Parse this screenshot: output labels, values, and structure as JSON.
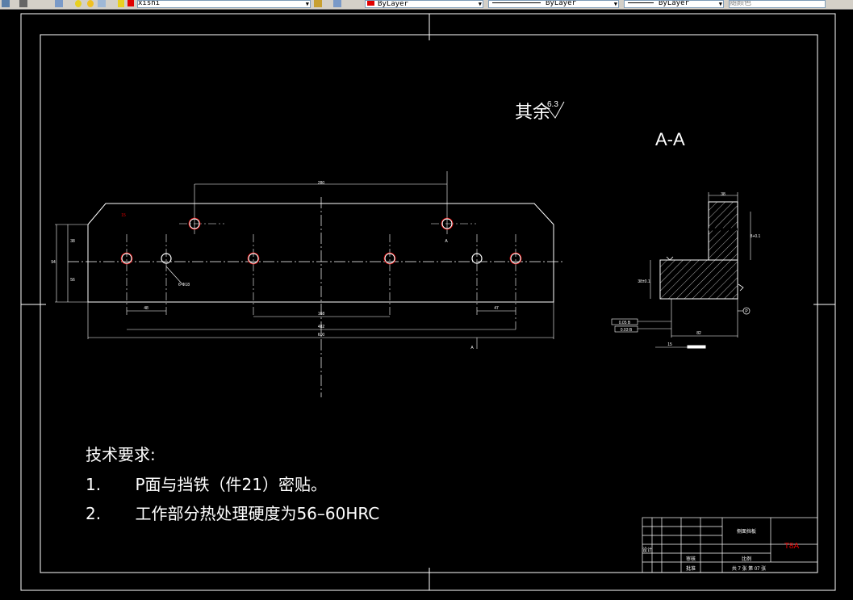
{
  "toolbar": {
    "layer_name": "xishi",
    "color_label": "ByLayer",
    "linetype_label": "ByLayer",
    "lineweight_label": "ByLayer",
    "plotstyle_label": "随颜色"
  },
  "drawing": {
    "surface_note_prefix": "其余",
    "surface_note_value": "6.3",
    "section_label": "A-A",
    "tech_title": "技术要求:",
    "tech_items": [
      {
        "num": "1.",
        "text": "P面与挡铁（件21）密贴。"
      },
      {
        "num": "2.",
        "text": "工作部分热处理硬度为56–60HRC"
      }
    ],
    "section_marks": [
      "A",
      "A"
    ],
    "dims": {
      "top_span": "280",
      "left_small": "48",
      "right_small": "47",
      "center_span": "168",
      "inner_span": "482",
      "overall_span": "600",
      "left_h1": "38",
      "left_h2": "56",
      "left_total": "94",
      "hole_note": "6-Φ18",
      "sec_top": "38",
      "sec_right": "8+0.1",
      "sec_left": "38±0.1",
      "sec_bottom": "82",
      "sec_small": "15",
      "sec_ref": "P",
      "tol1": "0.05 B",
      "tol2": "0.03 B"
    }
  },
  "title_block": {
    "part_name": "侧面挡板",
    "material": "T8A",
    "scale_label": "比例",
    "sheet_label": "共 7 张 第 07 张",
    "designer_label": "设计",
    "checker_label": "审核",
    "approve_label": "批准"
  }
}
